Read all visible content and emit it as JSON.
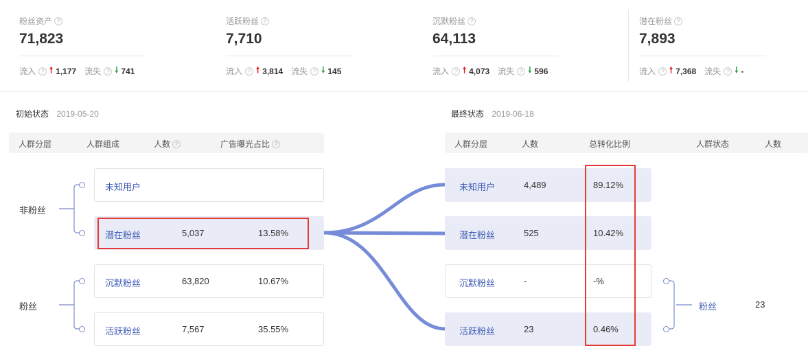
{
  "stats": [
    {
      "label": "粉丝资产",
      "value": "71,823",
      "in_label": "流入",
      "in": "1,177",
      "out_label": "流失",
      "out": "741"
    },
    {
      "label": "活跃粉丝",
      "value": "7,710",
      "in_label": "流入",
      "in": "3,814",
      "out_label": "流失",
      "out": "145"
    },
    {
      "label": "沉默粉丝",
      "value": "64,113",
      "in_label": "流入",
      "in": "4,073",
      "out_label": "流失",
      "out": "596"
    },
    {
      "label": "潜在粉丝",
      "value": "7,893",
      "in_label": "流入",
      "in": "7,368",
      "out_label": "流失",
      "out": "-"
    }
  ],
  "initial": {
    "label": "初始状态",
    "date": "2019-05-20",
    "headers": [
      "人群分层",
      "人群组成",
      "人数",
      "广告曝光占比"
    ],
    "groups": [
      "非粉丝",
      "粉丝"
    ],
    "rows": [
      {
        "name": "未知用户",
        "count": "",
        "ratio": ""
      },
      {
        "name": "潜在粉丝",
        "count": "5,037",
        "ratio": "13.58%"
      },
      {
        "name": "沉默粉丝",
        "count": "63,820",
        "ratio": "10.67%"
      },
      {
        "name": "活跃粉丝",
        "count": "7,567",
        "ratio": "35.55%"
      }
    ]
  },
  "final": {
    "label": "最终状态",
    "date": "2019-06-18",
    "headers": [
      "人群分层",
      "人数",
      "总转化比例",
      "人群状态",
      "人数"
    ],
    "rows": [
      {
        "name": "未知用户",
        "count": "4,489",
        "ratio": "89.12%"
      },
      {
        "name": "潜在粉丝",
        "count": "525",
        "ratio": "10.42%"
      },
      {
        "name": "沉默粉丝",
        "count": "-",
        "ratio": "-%"
      },
      {
        "name": "活跃粉丝",
        "count": "23",
        "ratio": "0.46%"
      }
    ],
    "state": {
      "name": "粉丝",
      "count": "23"
    }
  },
  "colors": {
    "accent": "#3d5bb5",
    "flow": "#6f86d6",
    "highlight": "#e53935",
    "up": "#e02020",
    "down": "#2ea24a"
  }
}
